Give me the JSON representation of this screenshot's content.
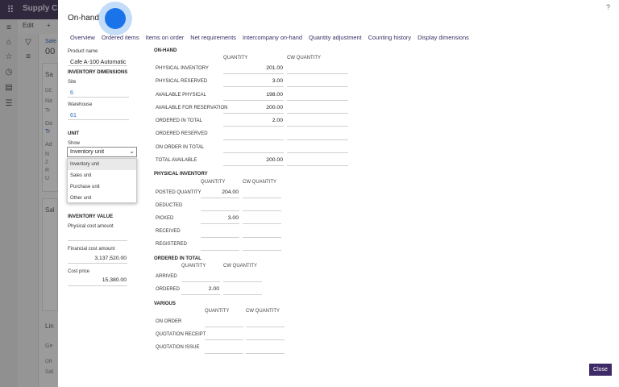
{
  "app": {
    "title": "Supply Chai",
    "edit_label": "Edit",
    "bg_fragments": [
      "Sale",
      "00",
      "Sa",
      "DE",
      "Na",
      "Tr",
      "Da",
      "Tr",
      "Ad",
      "N",
      "2",
      "R",
      "U",
      "Sal",
      "Lin",
      "Ge",
      "OR",
      "Sal"
    ]
  },
  "dialog": {
    "title": "On-hand",
    "tabs": [
      "Overview",
      "Ordered items",
      "Items on order",
      "Net requirements",
      "Intercompany on-hand",
      "Quantity adjustment",
      "Counting history",
      "Display dimensions"
    ],
    "close_label": "Close"
  },
  "left": {
    "product_name_label": "Product name",
    "product_name": "Cafe A-100 Automatic",
    "inv_dims_header": "INVENTORY DIMENSIONS",
    "site_label": "Site",
    "site_value": "6",
    "warehouse_label": "Warehouse",
    "warehouse_value": "61",
    "unit_header": "UNIT",
    "show_label": "Show",
    "show_value": "Inventory unit",
    "show_options": [
      "Inventory unit",
      "Sales unit",
      "Purchase unit",
      "Other unit"
    ],
    "inv_value_header": "INVENTORY VALUE",
    "physical_cost_label": "Physical cost amount",
    "financial_cost_label": "Financial cost amount",
    "financial_cost_value": "3,137,520.00",
    "cost_price_label": "Cost price",
    "cost_price_value": "15,380.00"
  },
  "onhand": {
    "header": "ON-HAND",
    "col_qty": "QUANTITY",
    "col_cw": "CW QUANTITY",
    "rows": [
      {
        "label": "PHYSICAL INVENTORY",
        "qty": "201.00"
      },
      {
        "label": "PHYSICAL RESERVED",
        "qty": "3.00"
      },
      {
        "label": "AVAILABLE PHYSICAL",
        "qty": "198.00"
      },
      {
        "label": "AVAILABLE FOR RESERVATION",
        "qty": "200.00"
      },
      {
        "label": "ORDERED IN TOTAL",
        "qty": "2.00"
      },
      {
        "label": "ORDERED RESERVED",
        "qty": ""
      },
      {
        "label": "ON ORDER IN TOTAL",
        "qty": ""
      },
      {
        "label": "TOTAL AVAILABLE",
        "qty": "200.00"
      }
    ]
  },
  "physical": {
    "header": "PHYSICAL INVENTORY",
    "col_qty": "QUANTITY",
    "col_cw": "CW QUANTITY",
    "rows": [
      {
        "label": "POSTED QUANTITY",
        "qty": "204.00"
      },
      {
        "label": "DEDUCTED",
        "qty": ""
      },
      {
        "label": "PICKED",
        "qty": "3.00"
      },
      {
        "label": "RECEIVED",
        "qty": ""
      },
      {
        "label": "REGISTERED",
        "qty": ""
      }
    ]
  },
  "ordered": {
    "header": "ORDERED IN TOTAL",
    "col_qty": "QUANTITY",
    "col_cw": "CW QUANTITY",
    "rows": [
      {
        "label": "ARRIVED",
        "qty": ""
      },
      {
        "label": "ORDERED",
        "qty": "2.00"
      }
    ]
  },
  "various": {
    "header": "VARIOUS",
    "col_qty": "QUANTITY",
    "col_cw": "CW QUANTITY",
    "rows": [
      {
        "label": "ON ORDER",
        "qty": ""
      },
      {
        "label": "QUOTATION RECEIPT",
        "qty": ""
      },
      {
        "label": "QUOTATION ISSUE",
        "qty": ""
      }
    ]
  }
}
